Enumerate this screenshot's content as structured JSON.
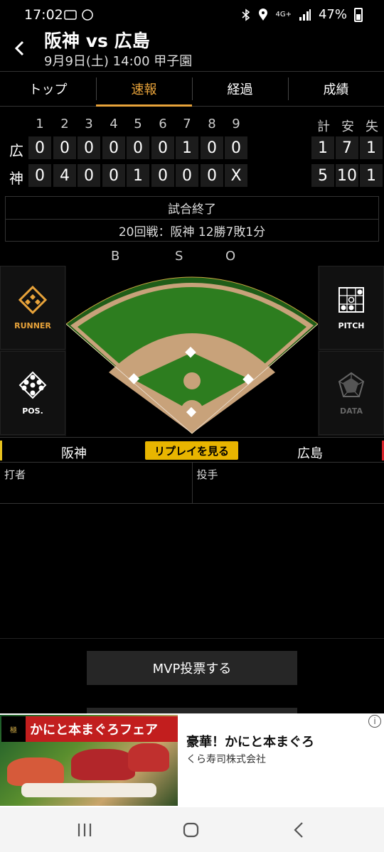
{
  "status_bar": {
    "time": "17:02",
    "battery": "47%",
    "network": "4G+"
  },
  "header": {
    "title": "阪神 vs 広島",
    "subtitle": "9月9日(土) 14:00 甲子園"
  },
  "tabs": [
    {
      "label": "トップ",
      "active": false
    },
    {
      "label": "速報",
      "active": true
    },
    {
      "label": "経過",
      "active": false
    },
    {
      "label": "成績",
      "active": false
    }
  ],
  "scoreboard": {
    "innings": [
      "1",
      "2",
      "3",
      "4",
      "5",
      "6",
      "7",
      "8",
      "9"
    ],
    "totals_headers": [
      "計",
      "安",
      "失"
    ],
    "rows": [
      {
        "team": "広",
        "scores": [
          "0",
          "0",
          "0",
          "0",
          "0",
          "0",
          "1",
          "0",
          "0"
        ],
        "totals": [
          "1",
          "7",
          "1"
        ]
      },
      {
        "team": "神",
        "scores": [
          "0",
          "4",
          "0",
          "0",
          "1",
          "0",
          "0",
          "0",
          "X"
        ],
        "totals": [
          "5",
          "10",
          "1"
        ]
      }
    ]
  },
  "result": {
    "status": "試合終了",
    "record": "20回戦：阪神 12勝7敗1分"
  },
  "bso": {
    "b": "B",
    "s": "S",
    "o": "O"
  },
  "side_buttons": {
    "runner": "RUNNER",
    "pitch": "PITCH",
    "pos": "POS.",
    "data": "DATA"
  },
  "team_strip": {
    "home": "阪神",
    "away": "広島",
    "replay": "リプレイを見る"
  },
  "batter_pitcher": {
    "batter": "打者",
    "pitcher": "投手"
  },
  "mvp_button": "MVP投票する",
  "ad": {
    "banner_text": "かにと本まぐろフェア",
    "title": "豪華！かにと本まぐろ",
    "advertiser": "くら寿司株式会社"
  },
  "colors": {
    "accent": "#e8a33a",
    "replay": "#e8b500",
    "tigers": "#e8c21e",
    "carp": "#d8232a"
  }
}
